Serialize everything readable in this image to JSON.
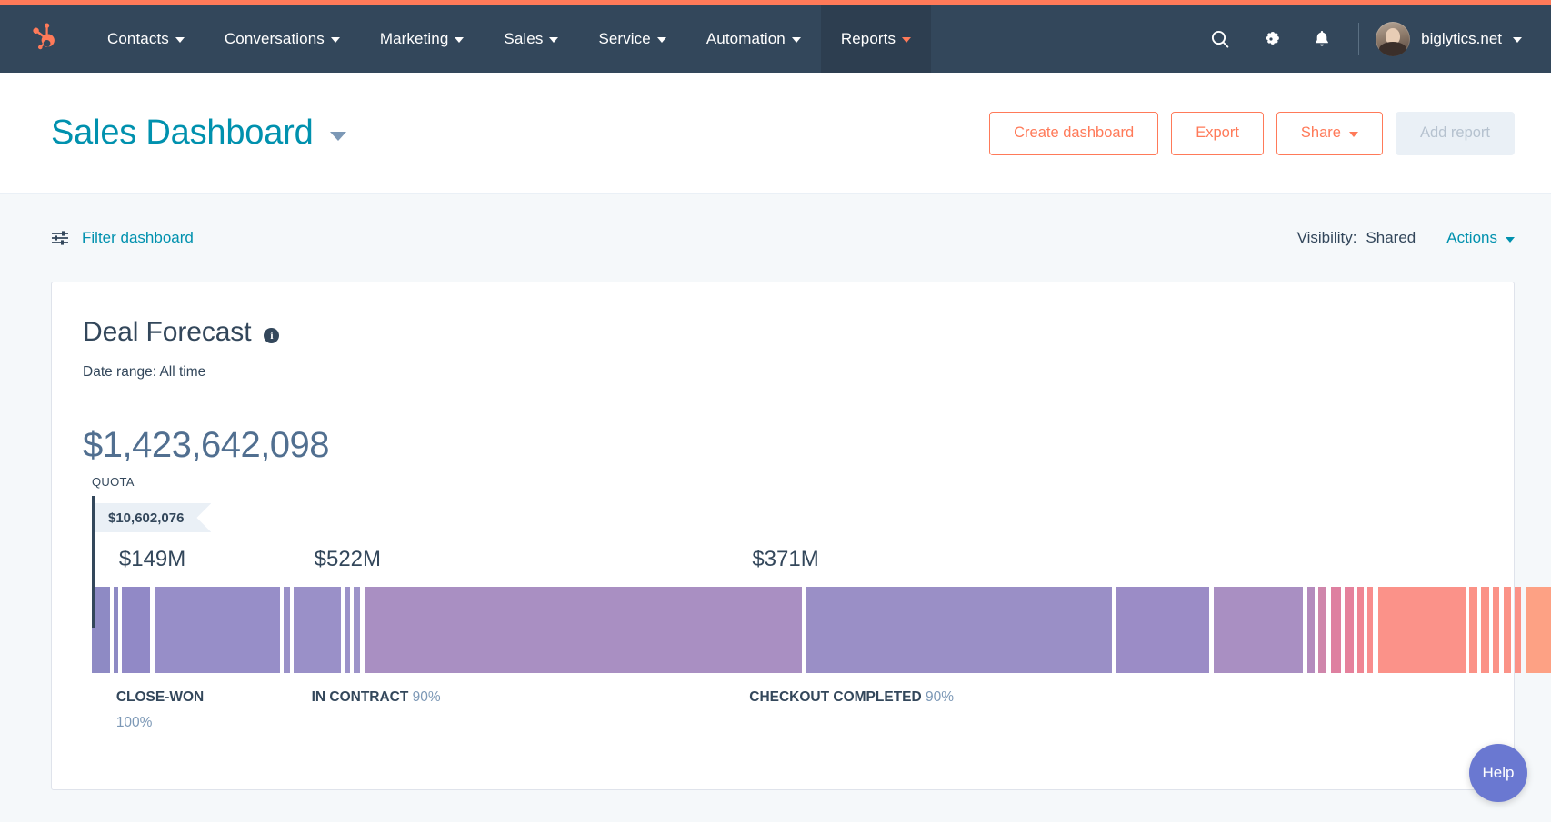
{
  "nav": {
    "logo_icon": "hubspot-sprocket-icon",
    "items": [
      {
        "label": "Contacts",
        "active": false
      },
      {
        "label": "Conversations",
        "active": false
      },
      {
        "label": "Marketing",
        "active": false
      },
      {
        "label": "Sales",
        "active": false
      },
      {
        "label": "Service",
        "active": false
      },
      {
        "label": "Automation",
        "active": false
      },
      {
        "label": "Reports",
        "active": true
      }
    ],
    "search_icon": "search-icon",
    "settings_icon": "gear-icon",
    "notifications_icon": "bell-icon",
    "account_name": "biglytics.net",
    "avatar_icon": "user-avatar"
  },
  "header": {
    "title": "Sales Dashboard",
    "buttons": [
      {
        "label": "Create dashboard",
        "style": "outline",
        "has_caret": false
      },
      {
        "label": "Export",
        "style": "outline",
        "has_caret": false
      },
      {
        "label": "Share",
        "style": "outline",
        "has_caret": true
      },
      {
        "label": "Add report",
        "style": "disabled",
        "has_caret": false
      }
    ]
  },
  "filter_bar": {
    "filter_icon": "sliders-icon",
    "filter_label": "Filter dashboard",
    "visibility_label": "Visibility:",
    "visibility_value": "Shared",
    "actions_label": "Actions"
  },
  "report": {
    "title": "Deal Forecast",
    "info_icon": "info-icon",
    "info_glyph": "i",
    "date_range_label": "Date range:",
    "date_range_value": "All time",
    "date_range_full": "Date range: All time",
    "total_value": "$1,423,642,098",
    "quota_caption": "QUOTA",
    "quota_amount": "$10,602,076"
  },
  "colors": {
    "brand_orange": "#ff7a59",
    "nav_dark": "#33475b",
    "teal": "#0091ae",
    "page_bg": "#f5f8fa",
    "muted": "#7c98b6"
  },
  "chart_data": {
    "type": "bar",
    "title": "Deal Forecast",
    "subtitle": "Date range: All time",
    "orientation": "horizontal-stacked",
    "total": "$1,423,642,098",
    "total_numeric": 1423642098,
    "quota": "$10,602,076",
    "quota_numeric": 10602076,
    "grid": false,
    "legend": false,
    "stage_value_labels": [
      {
        "text": "$149M",
        "left_pct": 2.6
      },
      {
        "text": "$522M",
        "left_pct": 16.6
      },
      {
        "text": "$371M",
        "left_pct": 48.0
      }
    ],
    "stage_labels": [
      {
        "name": "CLOSE-WON",
        "percent": "100%",
        "left_pct": 2.4
      },
      {
        "name": "IN CONTRACT",
        "percent": "90%",
        "left_pct": 16.4
      },
      {
        "name": "CHECKOUT COMPLETED",
        "percent": "90%",
        "left_pct": 47.8
      }
    ],
    "segments": [
      {
        "width_pct": 1.3,
        "color": "#8e8ac4",
        "gap": 0.3
      },
      {
        "width_pct": 0.28,
        "color": "#8e8ac4",
        "gap": 0.3
      },
      {
        "width_pct": 2.05,
        "color": "#9189c6",
        "gap": 0.3
      },
      {
        "width_pct": 9.05,
        "color": "#978ec8",
        "gap": 0.3
      },
      {
        "width_pct": 0.4,
        "color": "#9a91c8",
        "gap": 0.3
      },
      {
        "width_pct": 3.4,
        "color": "#9a90c8",
        "gap": 0.3
      },
      {
        "width_pct": 0.35,
        "color": "#9c92c9",
        "gap": 0.28
      },
      {
        "width_pct": 0.45,
        "color": "#9d93c9",
        "gap": 0.3
      },
      {
        "width_pct": 31.6,
        "color": "#a98fc2",
        "gap": 0.3
      },
      {
        "width_pct": 22.1,
        "color": "#9a8fc6",
        "gap": 0.3
      },
      {
        "width_pct": 6.7,
        "color": "#9b8cc6",
        "gap": 0.3
      },
      {
        "width_pct": 6.45,
        "color": "#a98fc2",
        "gap": 0.3
      },
      {
        "width_pct": 0.55,
        "color": "#b48bbd",
        "gap": 0.28
      },
      {
        "width_pct": 0.6,
        "color": "#cf86ab",
        "gap": 0.28
      },
      {
        "width_pct": 0.75,
        "color": "#de80a0",
        "gap": 0.28
      },
      {
        "width_pct": 0.62,
        "color": "#e5819c",
        "gap": 0.28
      },
      {
        "width_pct": 0.45,
        "color": "#ef8593",
        "gap": 0.28
      },
      {
        "width_pct": 0.42,
        "color": "#f88d8d",
        "gap": 0.35
      },
      {
        "width_pct": 6.3,
        "color": "#fb9289",
        "gap": 0.3
      },
      {
        "width_pct": 0.58,
        "color": "#fb9287",
        "gap": 0.28
      },
      {
        "width_pct": 0.55,
        "color": "#fb9287",
        "gap": 0.28
      },
      {
        "width_pct": 0.48,
        "color": "#fb9287",
        "gap": 0.28
      },
      {
        "width_pct": 0.52,
        "color": "#fb9287",
        "gap": 0.28
      },
      {
        "width_pct": 0.48,
        "color": "#fb9287",
        "gap": 0.3
      },
      {
        "width_pct": 2.2,
        "color": "#fda184",
        "gap": 0.3
      },
      {
        "width_pct": 0.55,
        "color": "#fda184",
        "gap": 0.28
      },
      {
        "width_pct": 0.5,
        "color": "#fd9a86",
        "gap": 0.28
      },
      {
        "width_pct": 0.55,
        "color": "#fd9a86",
        "gap": 0.28
      },
      {
        "width_pct": 0.52,
        "color": "#fd9a86",
        "gap": 0.28
      },
      {
        "width_pct": 0.48,
        "color": "#fd9a86",
        "gap": 0.3
      },
      {
        "width_pct": 2.45,
        "color": "#fb9289",
        "gap": 0.3
      },
      {
        "width_pct": 0.45,
        "color": "#fb9289",
        "gap": 0.28
      },
      {
        "width_pct": 0.42,
        "color": "#fb9289",
        "gap": 0.28
      },
      {
        "width_pct": 0.9,
        "color": "#fb9289",
        "gap": 0.0
      }
    ]
  },
  "help": {
    "label": "Help"
  }
}
